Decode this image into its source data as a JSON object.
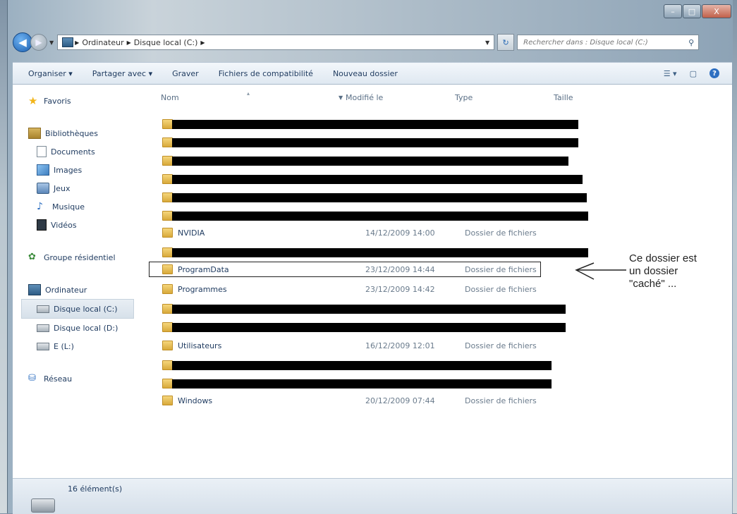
{
  "window": {
    "controls": {
      "minimize": "–",
      "maximize": "□",
      "close": "X"
    }
  },
  "address": {
    "crumbs": [
      "Ordinateur",
      "Disque local (C:)"
    ],
    "search_placeholder": "Rechercher dans : Disque local (C:)"
  },
  "toolbar": {
    "organize": "Organiser ▾",
    "share": "Partager avec ▾",
    "burn": "Graver",
    "compat": "Fichiers de compatibilité",
    "new_folder": "Nouveau dossier"
  },
  "nav": {
    "favorites": "Favoris",
    "libraries": "Bibliothèques",
    "documents": "Documents",
    "images": "Images",
    "games": "Jeux",
    "music": "Musique",
    "videos": "Vidéos",
    "homegroup": "Groupe résidentiel",
    "computer": "Ordinateur",
    "drive_c": "Disque local (C:)",
    "drive_d": "Disque local (D:)",
    "drive_e": "E (L:)",
    "network": "Réseau"
  },
  "columns": {
    "name": "Nom",
    "modified": "Modifié le",
    "type": "Type",
    "size": "Taille"
  },
  "files": {
    "nvidia": {
      "name": "NVIDIA",
      "modified": "14/12/2009 14:00",
      "type": "Dossier de fichiers"
    },
    "programdata": {
      "name": "ProgramData",
      "modified": "23/12/2009 14:44",
      "type": "Dossier de fichiers"
    },
    "programmes": {
      "name": "Programmes",
      "modified": "23/12/2009 14:42",
      "type": "Dossier de fichiers"
    },
    "utilisateurs": {
      "name": "Utilisateurs",
      "modified": "16/12/2009 12:01",
      "type": "Dossier de fichiers"
    },
    "windows": {
      "name": "Windows",
      "modified": "20/12/2009 07:44",
      "type": "Dossier de fichiers"
    }
  },
  "annotation": {
    "line1": "Ce dossier est",
    "line2": "un dossier",
    "line3": "\"caché\" ..."
  },
  "status": {
    "count": "16 élément(s)"
  }
}
